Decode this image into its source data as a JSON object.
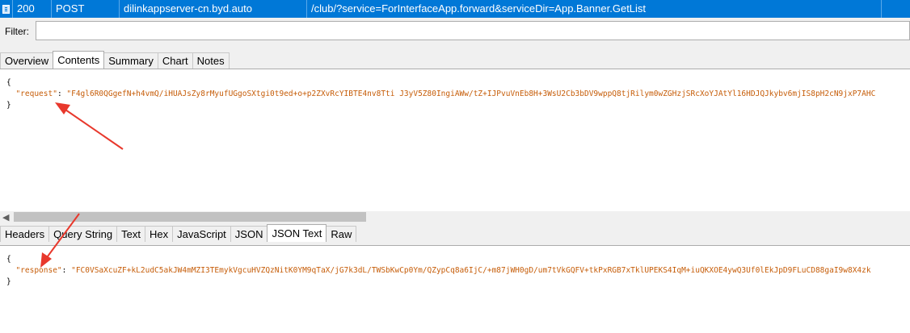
{
  "session": {
    "result": "200",
    "method": "POST",
    "host": "dilinkappserver-cn.byd.auto",
    "url": "/club/?service=ForInterfaceApp.forward&serviceDir=App.Banner.GetList"
  },
  "filter": {
    "label": "Filter:",
    "value": ""
  },
  "request_tabs": [
    {
      "label": "Overview"
    },
    {
      "label": "Contents"
    },
    {
      "label": "Summary"
    },
    {
      "label": "Chart"
    },
    {
      "label": "Notes"
    }
  ],
  "request_active_tab": "Contents",
  "request_json": {
    "open": "{",
    "key": "\"request\"",
    "colon": ": ",
    "value": "\"F4gl6R0QGgefN+h4vmQ/iHUAJsZy8rMyufUGgoSXtgi0t9ed+o+p2ZXvRcYIBTE4nv8Tti J3yV5Z80IngiAWw/tZ+IJPvuVnEb8H+3WsU2Cb3bDV9wppQ8tjRilym0wZGHzjSRcXoYJAtYl16HDJQJkybv6mjIS8pH2cN9jxP7AHC",
    "close": "}"
  },
  "response_tabs": [
    {
      "label": "Headers"
    },
    {
      "label": "Query String"
    },
    {
      "label": "Text"
    },
    {
      "label": "Hex"
    },
    {
      "label": "JavaScript"
    },
    {
      "label": "JSON"
    },
    {
      "label": "JSON Text"
    },
    {
      "label": "Raw"
    }
  ],
  "response_active_tab": "JSON Text",
  "response_json": {
    "open": "{",
    "key": "\"response\"",
    "colon": ": ",
    "value": "\"FC0VSaXcuZF+kL2udC5akJW4mMZI3TEmykVgcuHVZQzNitK0YM9qTaX/jG7k3dL/TWSbKwCp0Ym/QZypCq8a6IjC/+m87jWH0gD/um7tVkGQFV+tkPxRGB7xTklUPEKS4IqM+iuQKXOE4ywQ3Uf0lEkJpD9FLuCD88gaI9w8X4zk",
    "close": "}"
  },
  "colors": {
    "selection": "#0078d7",
    "json_string": "#c65d09",
    "arrow": "#e8382c"
  }
}
